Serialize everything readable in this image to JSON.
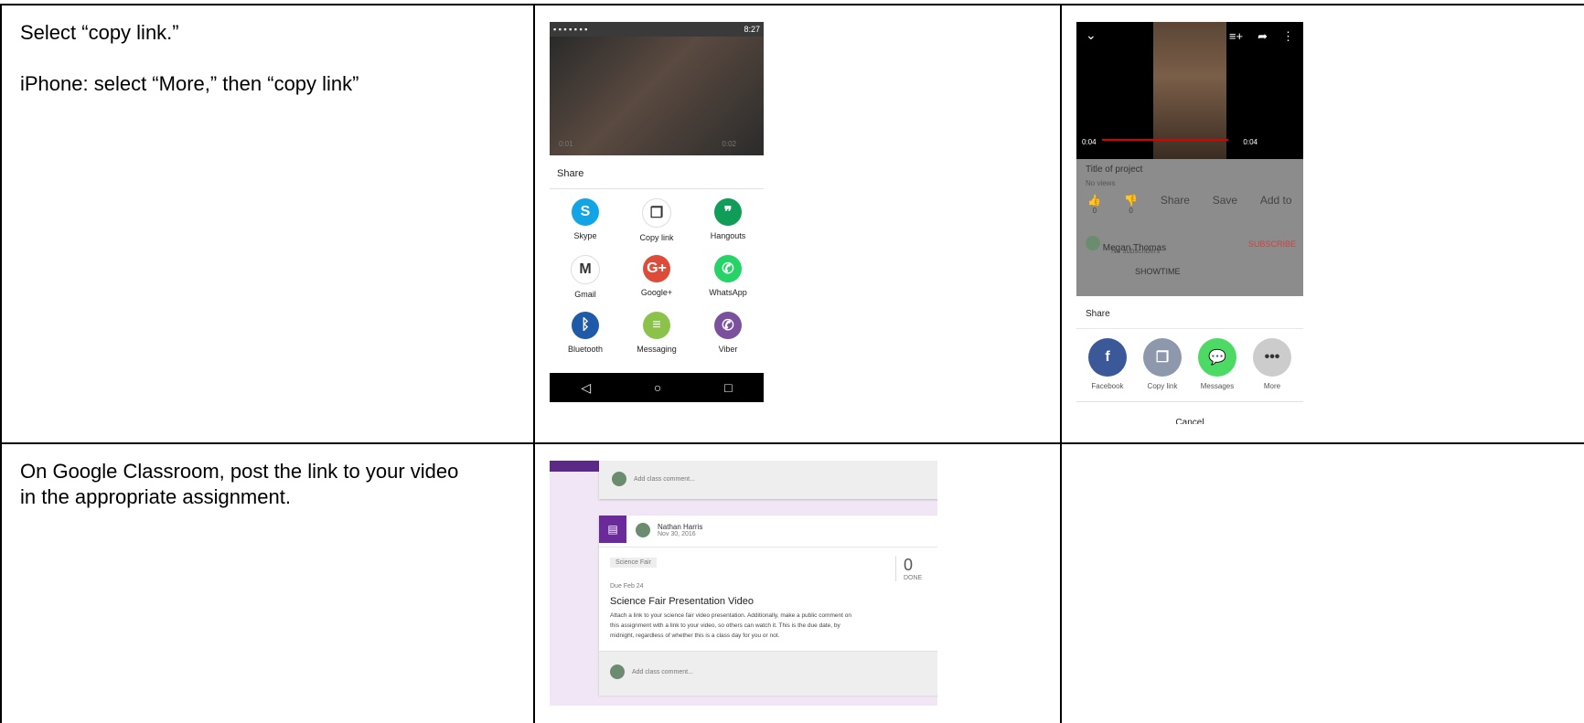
{
  "rows": [
    {
      "instruction_lines": [
        "Select “copy link.”",
        "",
        "iPhone: select “More,” then “copy link”"
      ]
    },
    {
      "instruction_lines": [
        "On Google Classroom, post the link to your video",
        "in the appropriate assignment."
      ]
    }
  ],
  "android": {
    "status_time": "8:27",
    "video_time_left": "0:01",
    "video_time_right": "0:02",
    "share_title": "Share",
    "apps": [
      {
        "label": "Skype",
        "color": "#12a5e6",
        "glyph": "S"
      },
      {
        "label": "Copy link",
        "color": "#ffffff",
        "glyph": "❐"
      },
      {
        "label": "Hangouts",
        "color": "#0f9d58",
        "glyph": "❞"
      },
      {
        "label": "Gmail",
        "color": "#ffffff",
        "glyph": "M"
      },
      {
        "label": "Google+",
        "color": "#dd4b39",
        "glyph": "G+"
      },
      {
        "label": "WhatsApp",
        "color": "#25d366",
        "glyph": "✆"
      },
      {
        "label": "Bluetooth",
        "color": "#1e5aa8",
        "glyph": "ᛒ"
      },
      {
        "label": "Messaging",
        "color": "#8bc34a",
        "glyph": "≡"
      },
      {
        "label": "Viber",
        "color": "#7b519d",
        "glyph": "✆"
      }
    ],
    "nav": [
      "◁",
      "○",
      "□"
    ]
  },
  "iphone": {
    "time_left": "0:04",
    "time_right": "0:04",
    "title": "Title of project",
    "views": "No views",
    "actions": [
      {
        "count": "0",
        "label": "👍"
      },
      {
        "count": "0",
        "label": "👎"
      },
      {
        "count": "",
        "label": "Share"
      },
      {
        "count": "",
        "label": "Save"
      },
      {
        "count": "",
        "label": "Add to"
      }
    ],
    "channel": "Megan Thomas",
    "channel_sub": "No subscribers",
    "subscribe": "SUBSCRIBE",
    "next_video": "SHOWTIME",
    "share_title": "Share",
    "share_items": [
      {
        "label": "Facebook",
        "color": "#3b5998",
        "glyph": "f"
      },
      {
        "label": "Copy link",
        "color": "#8e98ad",
        "glyph": "❐"
      },
      {
        "label": "Messages",
        "color": "#4cd964",
        "glyph": "💬"
      },
      {
        "label": "More",
        "color": "#cccccc",
        "glyph": "•••"
      }
    ],
    "cancel": "Cancel"
  },
  "classroom": {
    "comment_placeholder_top": "Add class comment...",
    "author": "Nathan Harris",
    "date": "Nov 30, 2016",
    "topic": "Science Fair",
    "due": "Due Feb 24",
    "done_count": "0",
    "done_label": "DONE",
    "assignment_title": "Science Fair Presentation Video",
    "assignment_body_1": "Attach a link to your science fair video presentation. Additionally, make a public comment on",
    "assignment_body_2": "this assignment with a link to your video, so others can watch it. This is the due date, by",
    "assignment_body_3": "midnight, regardless of whether this is a class day for you or not.",
    "comment_placeholder_bottom": "Add class comment..."
  }
}
